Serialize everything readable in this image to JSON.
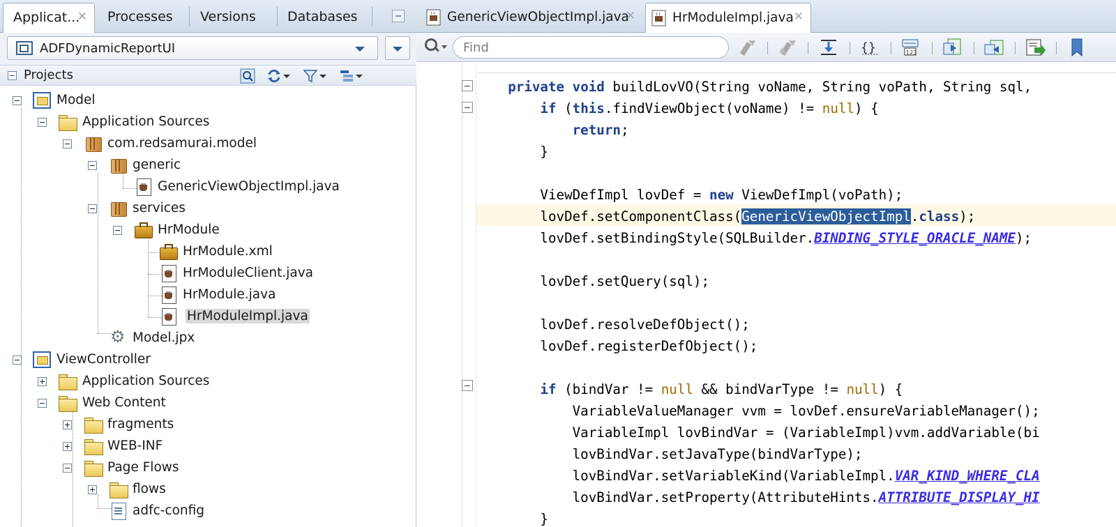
{
  "left_panel": {
    "tabs": [
      {
        "label": "Applicat...",
        "closable": true,
        "active": true
      },
      {
        "label": "Processes"
      },
      {
        "label": "Versions"
      },
      {
        "label": "Databases"
      }
    ],
    "application_selector": {
      "value": "ADFDynamicReportUI"
    },
    "projects_header": {
      "label": "Projects"
    },
    "tree": [
      {
        "label": "Model",
        "icon": "project-icon",
        "expanded": true
      },
      {
        "label": "Application Sources",
        "icon": "folder-icon",
        "expanded": true
      },
      {
        "label": "com.redsamurai.model",
        "icon": "package-icon",
        "expanded": true
      },
      {
        "label": "generic",
        "icon": "package-icon",
        "expanded": true
      },
      {
        "label": "GenericViewObjectImpl.java",
        "icon": "java-file-icon"
      },
      {
        "label": "services",
        "icon": "package-icon",
        "expanded": true
      },
      {
        "label": "HrModule",
        "icon": "application-module-icon",
        "expanded": true
      },
      {
        "label": "HrModule.xml",
        "icon": "application-module-icon"
      },
      {
        "label": "HrModuleClient.java",
        "icon": "java-file-icon"
      },
      {
        "label": "HrModule.java",
        "icon": "java-file-icon"
      },
      {
        "label": "HrModuleImpl.java",
        "icon": "java-file-icon",
        "selected": true
      },
      {
        "label": "Model.jpx",
        "icon": "gear-icon"
      },
      {
        "label": "ViewController",
        "icon": "project-icon",
        "expanded": true
      },
      {
        "label": "Application Sources",
        "icon": "folder-icon",
        "expanded": false
      },
      {
        "label": "Web Content",
        "icon": "folder-icon",
        "expanded": true
      },
      {
        "label": "fragments",
        "icon": "folder-icon",
        "expanded": false
      },
      {
        "label": "WEB-INF",
        "icon": "folder-icon",
        "expanded": false
      },
      {
        "label": "Page Flows",
        "icon": "folder-icon",
        "expanded": true
      },
      {
        "label": "flows",
        "icon": "folder-icon",
        "expanded": false
      },
      {
        "label": "adfc-config",
        "icon": "config-file-icon"
      }
    ]
  },
  "editor": {
    "tabs": [
      {
        "label": "GenericViewObjectImpl.java",
        "active": false
      },
      {
        "label": "HrModuleImpl.java",
        "active": true
      }
    ],
    "find": {
      "placeholder": "Find",
      "value": ""
    },
    "selection": "GenericViewObjectImpl",
    "code_lines": [
      "    private void buildLovVO(String voName, String voPath, String sql, ",
      "        if (this.findViewObject(voName) != null) {",
      "            return;",
      "        }",
      "",
      "        ViewDefImpl lovDef = new ViewDefImpl(voPath);",
      "        lovDef.setComponentClass(GenericViewObjectImpl.class);",
      "        lovDef.setBindingStyle(SQLBuilder.BINDING_STYLE_ORACLE_NAME);",
      "",
      "        lovDef.setQuery(sql);",
      "",
      "        lovDef.resolveDefObject();",
      "        lovDef.registerDefObject();",
      "",
      "        if (bindVar != null && bindVarType != null) {",
      "            VariableValueManager vvm = lovDef.ensureVariableManager();",
      "            VariableImpl lovBindVar = (VariableImpl)vvm.addVariable(bi",
      "            lovBindVar.setJavaType(bindVarType);",
      "            lovBindVar.setVariableKind(VariableImpl.VAR_KIND_WHERE_CLA",
      "            lovBindVar.setProperty(AttributeHints.ATTRIBUTE_DISPLAY_HI",
      "        }"
    ]
  }
}
